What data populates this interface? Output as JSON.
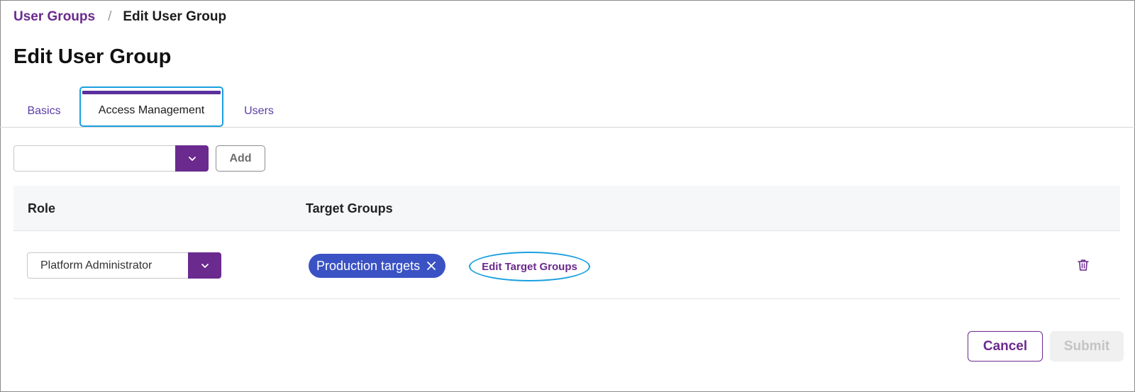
{
  "breadcrumb": {
    "parent": "User Groups",
    "separator": "/",
    "current": "Edit User Group"
  },
  "page": {
    "title": "Edit User Group"
  },
  "tabs": [
    {
      "label": "Basics"
    },
    {
      "label": "Access Management",
      "active": true
    },
    {
      "label": "Users"
    }
  ],
  "add_row": {
    "select_value": "",
    "add_label": "Add"
  },
  "table": {
    "headers": {
      "role": "Role",
      "target_groups": "Target Groups"
    },
    "rows": [
      {
        "role": "Platform Administrator",
        "target_groups": [
          "Production targets"
        ],
        "edit_label": "Edit Target Groups"
      }
    ]
  },
  "footer": {
    "cancel_label": "Cancel",
    "submit_label": "Submit"
  },
  "colors": {
    "brand": "#6b2a8e",
    "chip": "#3a52c4",
    "tab_accent": "#5a2f9e",
    "highlight": "#1aa0e0"
  },
  "icons": {
    "dropdown": "chevron-down-icon",
    "chip_remove": "close-icon",
    "delete": "trash-icon"
  }
}
